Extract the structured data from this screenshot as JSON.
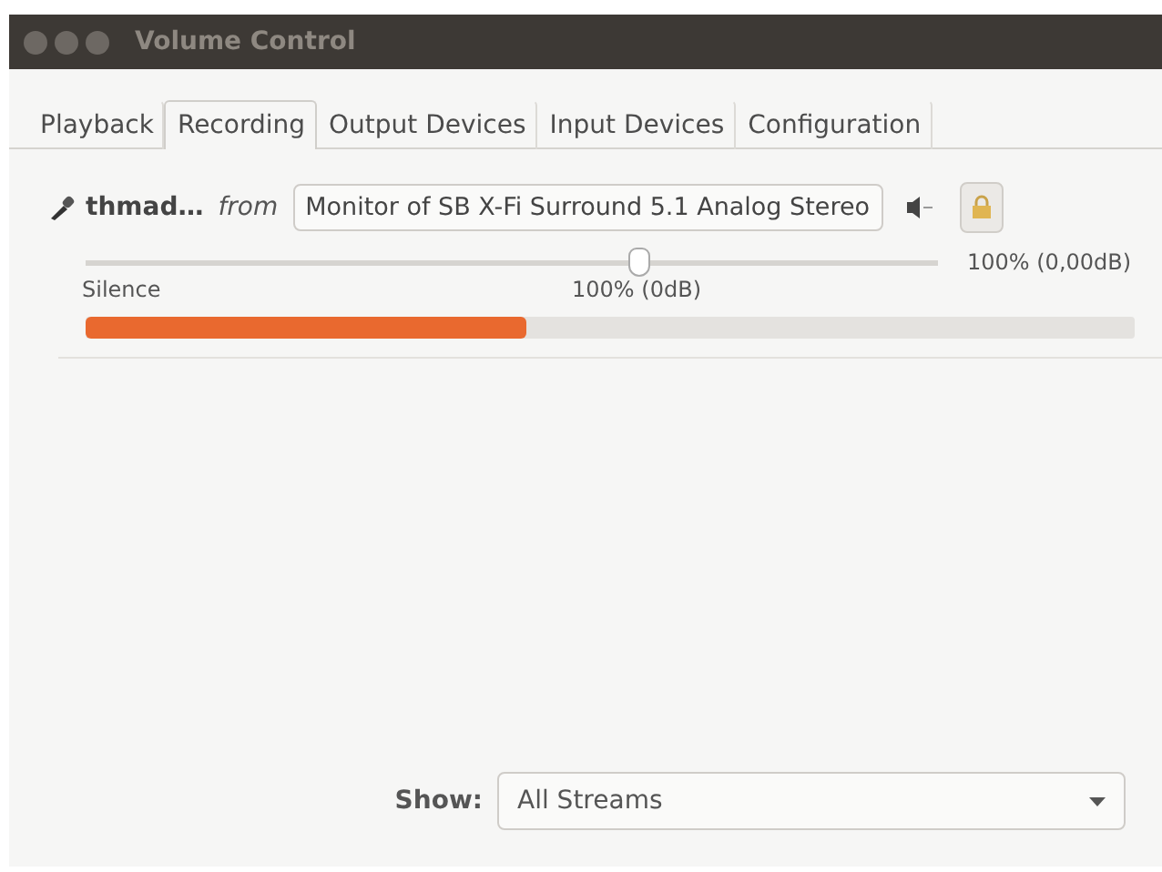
{
  "window": {
    "title": "Volume Control"
  },
  "tabs": [
    {
      "label": "Playback",
      "selected": false
    },
    {
      "label": "Recording",
      "selected": true
    },
    {
      "label": "Output Devices",
      "selected": false
    },
    {
      "label": "Input Devices",
      "selected": false
    },
    {
      "label": "Configuration",
      "selected": false
    }
  ],
  "stream": {
    "name": "thmad…",
    "from": "from",
    "source": "Monitor of SB X-Fi Surround 5.1 Analog Stereo",
    "locked": true,
    "volume": {
      "level": 0.65,
      "reading": "100% (0,00dB)"
    },
    "scale_left": "Silence",
    "scale_mid": "100% (0dB)",
    "meter": {
      "level": 0.42
    }
  },
  "show": {
    "label": "Show:",
    "value": "All Streams"
  }
}
